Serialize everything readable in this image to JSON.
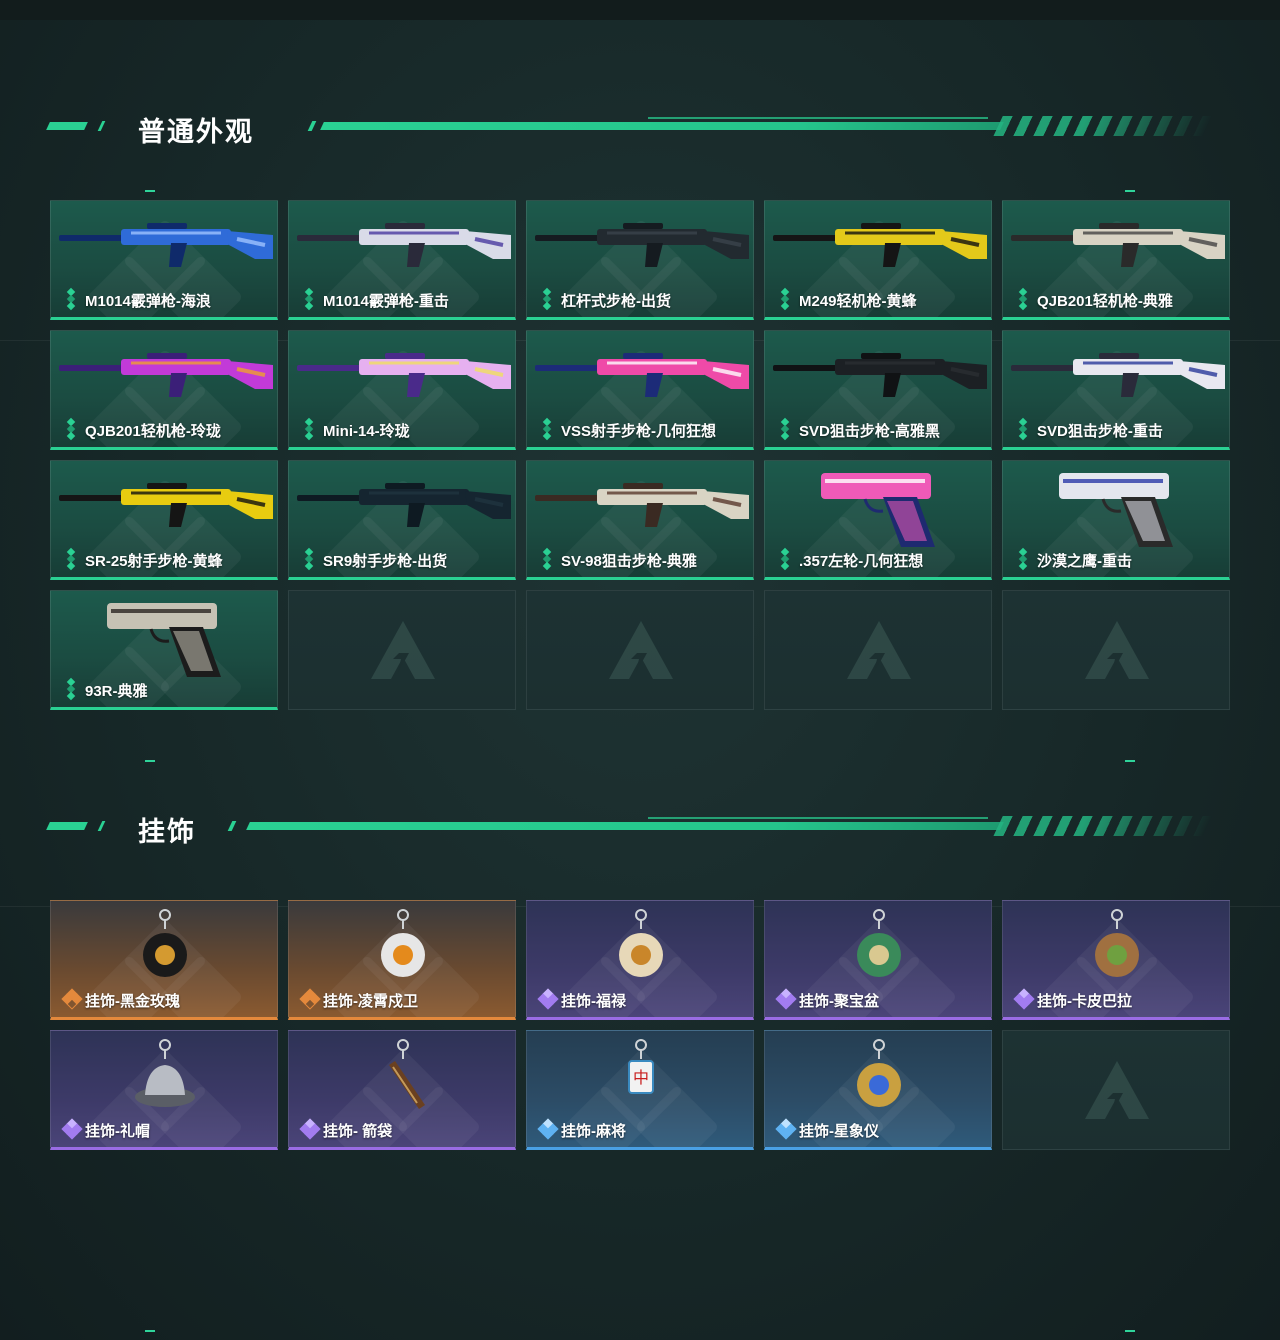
{
  "sections": [
    {
      "title": "普通外观",
      "items": [
        {
          "label": "M1014霰弹枪-海浪",
          "rarity": "green",
          "art": "shotgun-blue-icon"
        },
        {
          "label": "M1014霰弹枪-重击",
          "rarity": "green",
          "art": "shotgun-white-icon"
        },
        {
          "label": "杠杆式步枪-出货",
          "rarity": "green",
          "art": "lever-rifle-icon"
        },
        {
          "label": "M249轻机枪-黄蜂",
          "rarity": "green",
          "art": "lmg-yellow-icon"
        },
        {
          "label": "QJB201轻机枪-典雅",
          "rarity": "green",
          "art": "lmg-white-icon"
        },
        {
          "label": "QJB201轻机枪-玲珑",
          "rarity": "green",
          "art": "lmg-purple-icon"
        },
        {
          "label": "Mini-14-玲珑",
          "rarity": "green",
          "art": "rifle-pastel-icon"
        },
        {
          "label": "VSS射手步枪-几何狂想",
          "rarity": "green",
          "art": "vss-pink-icon"
        },
        {
          "label": "SVD狙击步枪-高雅黑",
          "rarity": "green",
          "art": "svd-black-icon"
        },
        {
          "label": "SVD狙击步枪-重击",
          "rarity": "green",
          "art": "svd-white-icon"
        },
        {
          "label": "SR-25射手步枪-黄蜂",
          "rarity": "green",
          "art": "sr25-yellow-icon"
        },
        {
          "label": "SR9射手步枪-出货",
          "rarity": "green",
          "art": "sr9-dark-icon"
        },
        {
          "label": "SV-98狙击步枪-典雅",
          "rarity": "green",
          "art": "sv98-white-icon"
        },
        {
          "label": ".357左轮-几何狂想",
          "rarity": "green",
          "art": "revolver-pink-icon"
        },
        {
          "label": "沙漠之鹰-重击",
          "rarity": "green",
          "art": "deagle-white-icon"
        },
        {
          "label": "93R-典雅",
          "rarity": "green",
          "art": "pistol-camo-icon"
        },
        {
          "label": "",
          "rarity": "empty"
        },
        {
          "label": "",
          "rarity": "empty"
        },
        {
          "label": "",
          "rarity": "empty"
        },
        {
          "label": "",
          "rarity": "empty"
        }
      ]
    },
    {
      "title": "挂饰",
      "items": [
        {
          "label": "挂饰-黑金玫瑰",
          "rarity": "orange",
          "art": "charm-rose-icon"
        },
        {
          "label": "挂饰-凌霄戍卫",
          "rarity": "orange",
          "art": "charm-bird-icon"
        },
        {
          "label": "挂饰-福禄",
          "rarity": "purple",
          "art": "charm-gourd-icon"
        },
        {
          "label": "挂饰-聚宝盆",
          "rarity": "purple",
          "art": "charm-bowl-icon"
        },
        {
          "label": "挂饰-卡皮巴拉",
          "rarity": "purple",
          "art": "charm-capybara-icon"
        },
        {
          "label": "挂饰-礼帽",
          "rarity": "purple",
          "art": "charm-hat-icon"
        },
        {
          "label": "挂饰- 箭袋",
          "rarity": "purple",
          "art": "charm-quiver-icon"
        },
        {
          "label": "挂饰-麻将",
          "rarity": "blue",
          "art": "charm-mahjong-icon"
        },
        {
          "label": "挂饰-星象仪",
          "rarity": "blue",
          "art": "charm-astrolabe-icon"
        },
        {
          "label": "",
          "rarity": "empty"
        }
      ]
    }
  ],
  "mahjong_glyph": "中",
  "colors": {
    "accent": "#2ad193",
    "orange": "#e4893c",
    "purple": "#9a6ce4",
    "blue": "#4aa0e4"
  }
}
